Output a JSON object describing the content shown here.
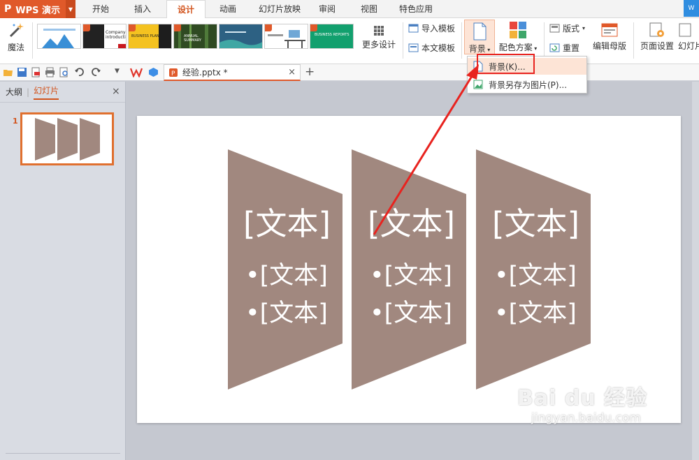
{
  "app": {
    "title": "WPS 演示"
  },
  "menu": {
    "tabs": [
      {
        "label": "开始"
      },
      {
        "label": "插入"
      },
      {
        "label": "设计"
      },
      {
        "label": "动画"
      },
      {
        "label": "幻灯片放映"
      },
      {
        "label": "审阅"
      },
      {
        "label": "视图"
      },
      {
        "label": "特色应用"
      }
    ],
    "corner": "W"
  },
  "ribbon": {
    "magic_label": "魔法",
    "templates": [
      {
        "caption": ""
      },
      {
        "caption": "Company introduction"
      },
      {
        "caption": "BUSINESS PLAN"
      },
      {
        "caption": "ANNUAL SUMMARY"
      },
      {
        "caption": ""
      },
      {
        "caption": ""
      },
      {
        "caption": "BUSINESS REPORTS"
      }
    ],
    "more_design": "更多设计",
    "import_template": "导入模板",
    "this_template": "本文模板",
    "background": "背景",
    "color_scheme": "配色方案",
    "layout": "版式",
    "reset": "重置",
    "edit_master": "编辑母版",
    "page_setup": "页面设置",
    "slide_size": "幻灯片"
  },
  "toolbar": {
    "document_tab": "经验.pptx *",
    "close": "×",
    "add": "+"
  },
  "left_panel": {
    "tab_outline": "大纲",
    "tab_slides": "幻灯片",
    "close": "×",
    "slide_number": "1"
  },
  "slide": {
    "columns": [
      {
        "title": "[文本]",
        "bullets": [
          "[文本]",
          "[文本]"
        ]
      },
      {
        "title": "[文本]",
        "bullets": [
          "[文本]",
          "[文本]"
        ]
      },
      {
        "title": "[文本]",
        "bullets": [
          "[文本]",
          "[文本]"
        ]
      }
    ],
    "shape_color": "#a1887f"
  },
  "dropdown": {
    "items": [
      {
        "label": "背景(K)..."
      },
      {
        "label": "背景另存为图片(P)..."
      }
    ]
  },
  "colors": {
    "accent": "#e0592a",
    "highlight": "#e8231f"
  },
  "watermark": {
    "logo": "Bai du 经验",
    "url": "jingyan.baidu.com"
  }
}
